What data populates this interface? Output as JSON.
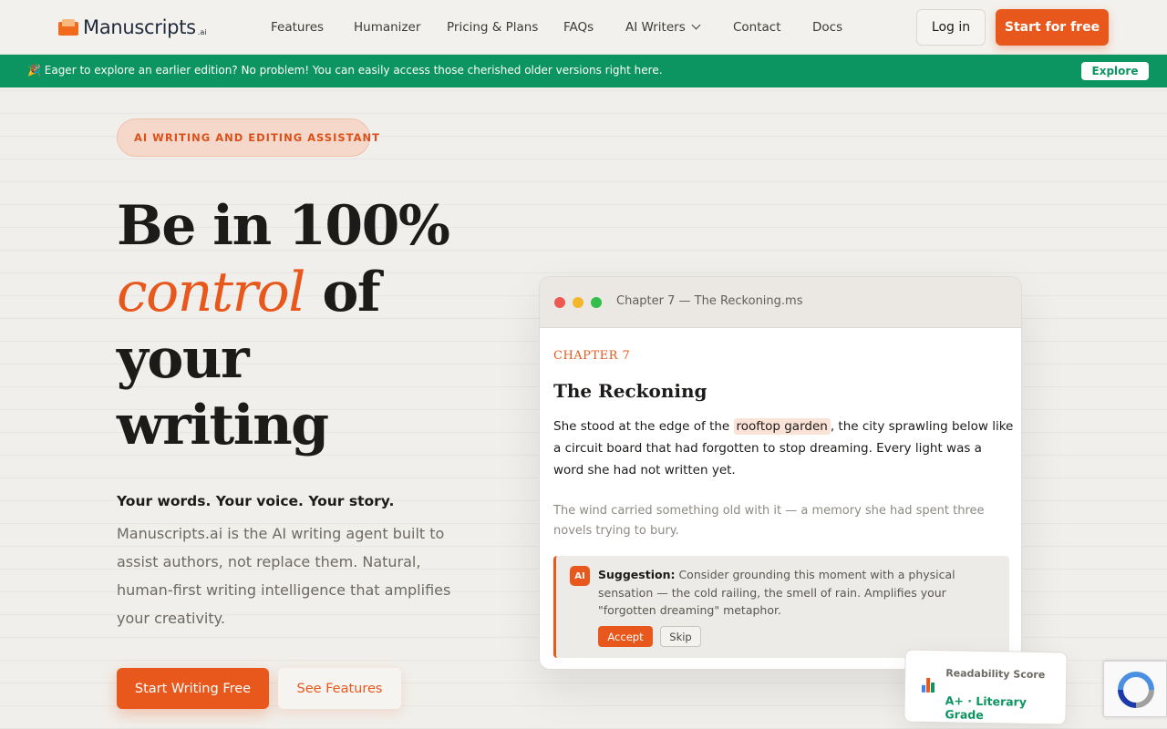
{
  "nav": {
    "logo_text": "Manuscripts",
    "logo_suffix": ".ai",
    "links": [
      "Features",
      "Humanizer",
      "Pricing & Plans",
      "FAQs",
      "AI Writers",
      "Contact",
      "Docs"
    ],
    "login": "Log in",
    "start": "Start for free"
  },
  "banner": {
    "text": "🎉 Eager to explore an earlier edition? No problem! You can easily access those cherished older versions right here.",
    "button": "Explore"
  },
  "hero": {
    "pill": "AI WRITING AND EDITING ASSISTANT",
    "headline_1": "Be in 100%",
    "headline_accent": "control",
    "headline_2": " of",
    "headline_3": "your",
    "headline_4": "writing",
    "subhead": "Your words. Your voice. Your story.",
    "description": "Manuscripts.ai is the AI writing agent built to assist authors, not replace them. Natural, human-first writing intelligence that amplifies your creativity.",
    "cta_primary": "Start Writing Free",
    "cta_secondary": "See Features"
  },
  "editor": {
    "file_title": "Chapter 7 — The Reckoning.ms",
    "chapter_label": "CHAPTER 7",
    "chapter_title": "The Reckoning",
    "para1_before": "She stood at the edge of the ",
    "para1_highlight": "rooftop garden",
    "para1_after": ", the city sprawling below like a circuit board that had forgotten to stop dreaming. Every light was a word she had not written yet.",
    "para2": "The wind carried something old with it — a memory she had spent three novels trying to bury.",
    "suggestion": {
      "badge": "AI",
      "label": "Suggestion:",
      "text": " Consider grounding this moment with a physical sensation — the cold railing, the smell of rain. Amplifies your \"forgotten dreaming\" metaphor.",
      "accept": "Accept",
      "skip": "Skip"
    }
  },
  "readability": {
    "label": "Readability Score",
    "value": "A+ · Literary Grade",
    "icon": "bar-chart-icon"
  },
  "colors": {
    "accent": "#e8581c",
    "banner": "#0c9461"
  }
}
